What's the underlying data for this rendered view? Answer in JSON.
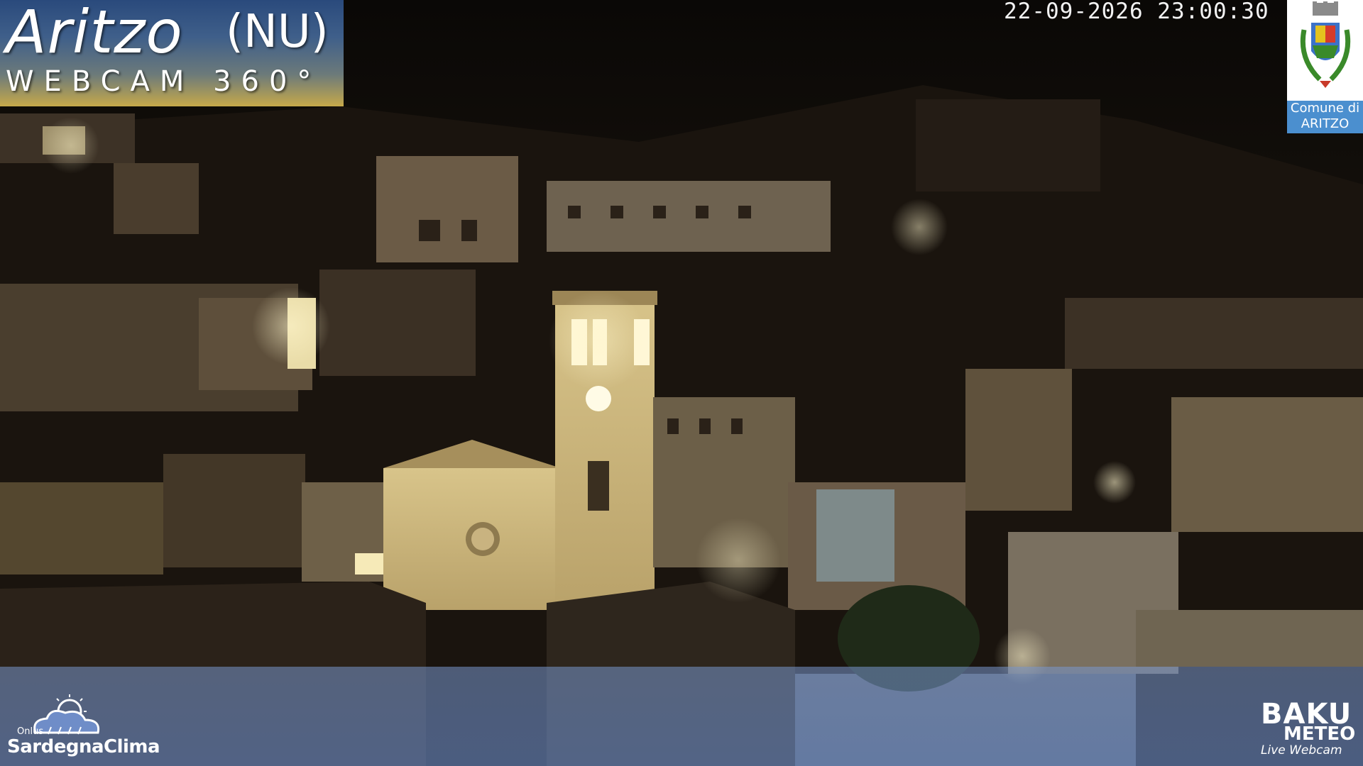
{
  "overlay": {
    "title": "Aritzo",
    "province": "(NU)",
    "subtitle": "WEBCAM 360°",
    "timestamp": "22-09-2026 23:00:30"
  },
  "crest": {
    "line1": "Comune di",
    "line2": "ARITZO"
  },
  "credits": {
    "left_onlus": "Onlus",
    "left_name": "SardegnaClima",
    "right_main": "BAKU",
    "right_sub": "METEO",
    "right_tag": "Live Webcam"
  },
  "scene": {
    "description_icon": "night-village-photo",
    "accent_warm": "#f6e6a8",
    "band_blue": "#6f8dc8"
  }
}
